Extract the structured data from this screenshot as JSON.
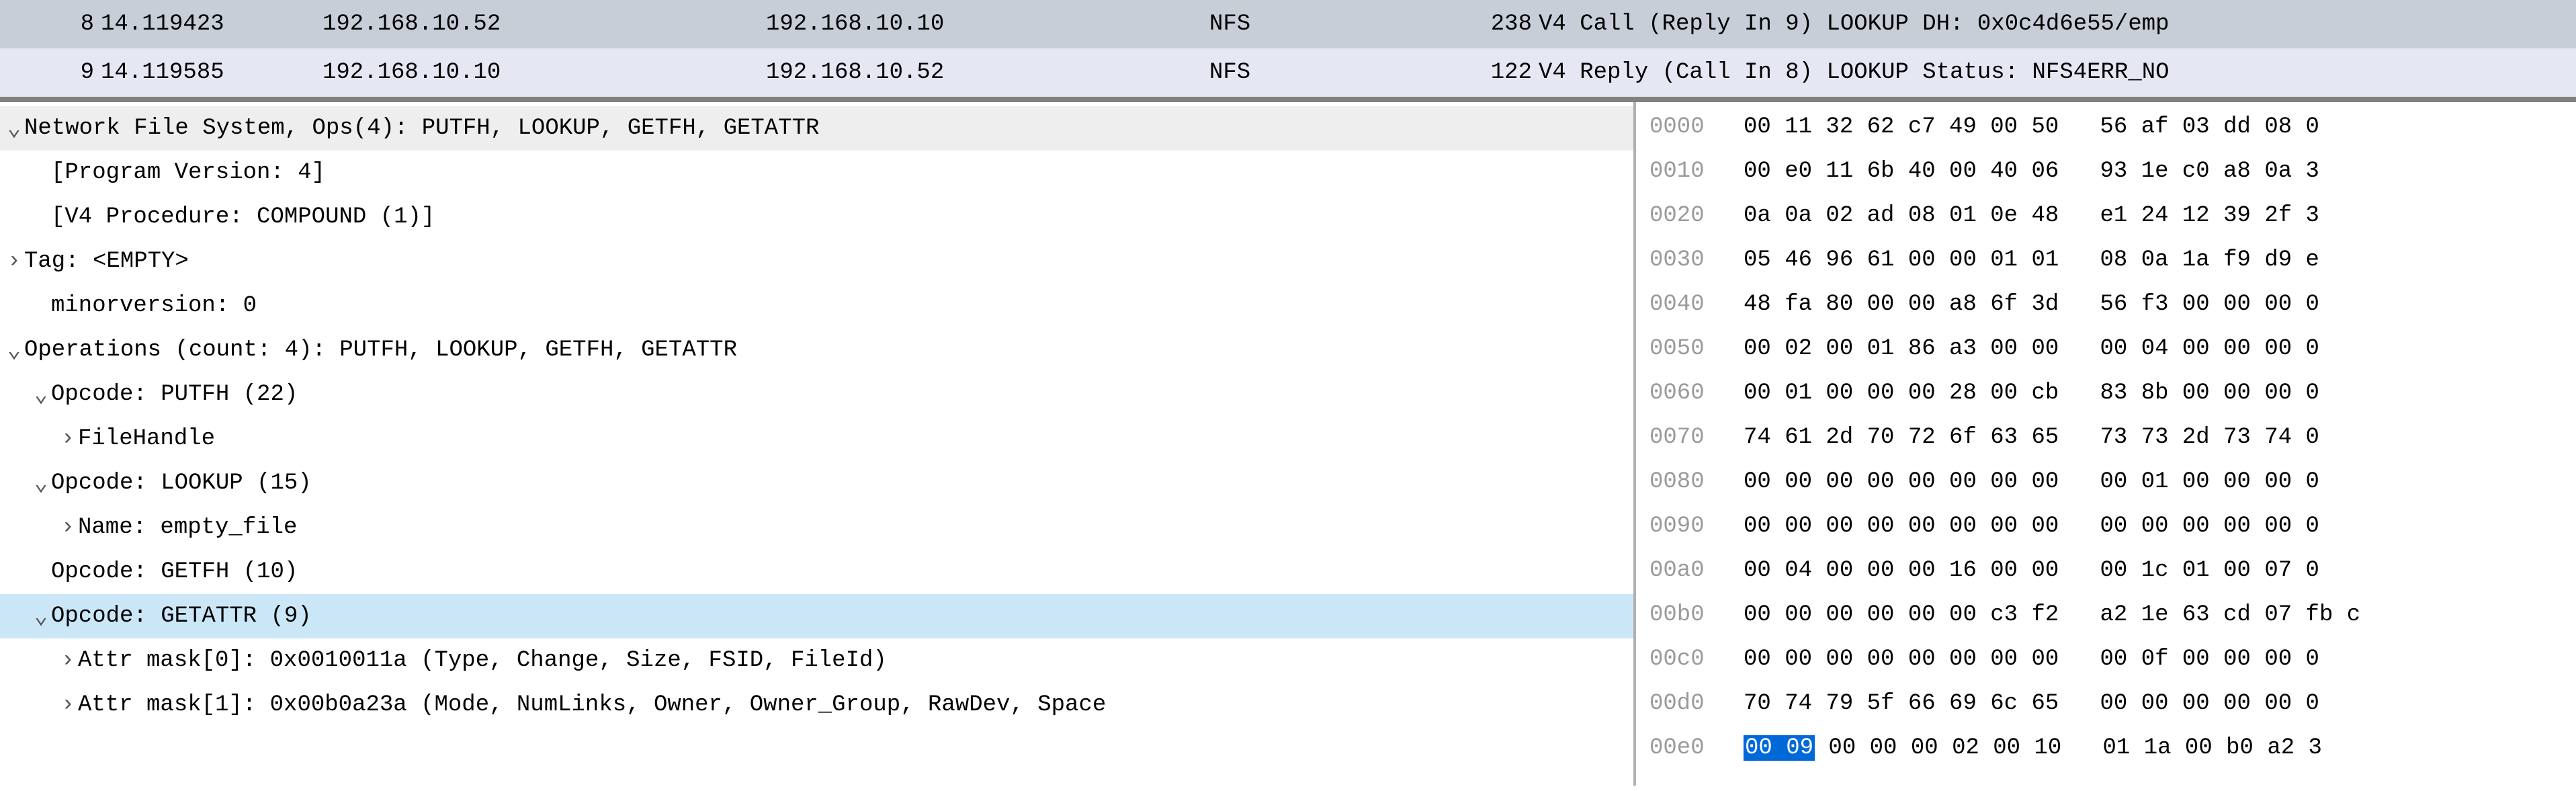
{
  "packet_list": [
    {
      "no": "8",
      "time": "14.119423",
      "src": "192.168.10.52",
      "dst": "192.168.10.10",
      "proto": "NFS",
      "len": "238",
      "info": "V4 Call (Reply In 9) LOOKUP DH: 0x0c4d6e55/emp",
      "cls": "sel"
    },
    {
      "no": "9",
      "time": "14.119585",
      "src": "192.168.10.10",
      "dst": "192.168.10.52",
      "proto": "NFS",
      "len": "122",
      "info": "V4 Reply (Call In 8) LOOKUP Status: NFS4ERR_NO",
      "cls": "alt"
    }
  ],
  "tree": [
    {
      "cls": "tree-line hdr",
      "caret": "⌄",
      "text": "Network File System, Ops(4): PUTFH, LOOKUP, GETFH, GETATTR"
    },
    {
      "cls": "tree-line indent-1",
      "caret": "",
      "text": "[Program Version: 4]"
    },
    {
      "cls": "tree-line indent-1",
      "caret": "",
      "text": "[V4 Procedure: COMPOUND (1)]"
    },
    {
      "cls": "tree-line",
      "caret": "›",
      "text": "Tag: <EMPTY>"
    },
    {
      "cls": "tree-line indent-1",
      "caret": "",
      "text": "minorversion: 0"
    },
    {
      "cls": "tree-line",
      "caret": "⌄",
      "text": "Operations (count: 4): PUTFH, LOOKUP, GETFH, GETATTR"
    },
    {
      "cls": "tree-line indent-1",
      "caret": "⌄",
      "text": "Opcode: PUTFH (22)"
    },
    {
      "cls": "tree-line indent-2",
      "caret": "›",
      "text": "FileHandle"
    },
    {
      "cls": "tree-line indent-1",
      "caret": "⌄",
      "text": "Opcode: LOOKUP (15)"
    },
    {
      "cls": "tree-line indent-2",
      "caret": "›",
      "text": "Name: empty_file"
    },
    {
      "cls": "tree-line indent-1",
      "caret": "",
      "text": "Opcode: GETFH (10)"
    },
    {
      "cls": "tree-line indent-1 sel",
      "caret": "⌄",
      "text": "Opcode: GETATTR (9)"
    },
    {
      "cls": "tree-line indent-2",
      "caret": "›",
      "text": "Attr mask[0]: 0x0010011a (Type, Change, Size, FSID, FileId)"
    },
    {
      "cls": "tree-line indent-2",
      "caret": "›",
      "text": "Attr mask[1]: 0x00b0a23a (Mode, NumLinks, Owner, Owner_Group, RawDev, Space"
    }
  ],
  "hex": [
    {
      "off": "0000",
      "b1": "00 11 32 62 c7 49 00 50",
      "b2": "56 af 03 dd 08 0"
    },
    {
      "off": "0010",
      "b1": "00 e0 11 6b 40 00 40 06",
      "b2": "93 1e c0 a8 0a 3"
    },
    {
      "off": "0020",
      "b1": "0a 0a 02 ad 08 01 0e 48",
      "b2": "e1 24 12 39 2f 3"
    },
    {
      "off": "0030",
      "b1": "05 46 96 61 00 00 01 01",
      "b2": "08 0a 1a f9 d9 e"
    },
    {
      "off": "0040",
      "b1": "48 fa 80 00 00 a8 6f 3d",
      "b2": "56 f3 00 00 00 0"
    },
    {
      "off": "0050",
      "b1": "00 02 00 01 86 a3 00 00",
      "b2": "00 04 00 00 00 0"
    },
    {
      "off": "0060",
      "b1": "00 01 00 00 00 28 00 cb",
      "b2": "83 8b 00 00 00 0"
    },
    {
      "off": "0070",
      "b1": "74 61 2d 70 72 6f 63 65",
      "b2": "73 73 2d 73 74 0"
    },
    {
      "off": "0080",
      "b1": "00 00 00 00 00 00 00 00",
      "b2": "00 01 00 00 00 0"
    },
    {
      "off": "0090",
      "b1": "00 00 00 00 00 00 00 00",
      "b2": "00 00 00 00 00 0"
    },
    {
      "off": "00a0",
      "b1": "00 04 00 00 00 16 00 00",
      "b2": "00 1c 01 00 07 0"
    },
    {
      "off": "00b0",
      "b1": "00 00 00 00 00 00 c3 f2",
      "b2": "a2 1e 63 cd 07 fb c"
    },
    {
      "off": "00c0",
      "b1": "00 00 00 00 00 00 00 00",
      "b2": "00 0f 00 00 00 0"
    },
    {
      "off": "00d0",
      "b1": "70 74 79 5f 66 69 6c 65",
      "b2": "00 00 00 00 00 0"
    },
    {
      "off": "00e0",
      "b1_hl": "00 09",
      "b1_rest": " 00 00 00 02 00 10",
      "b2": "01 1a 00 b0 a2 3"
    }
  ]
}
